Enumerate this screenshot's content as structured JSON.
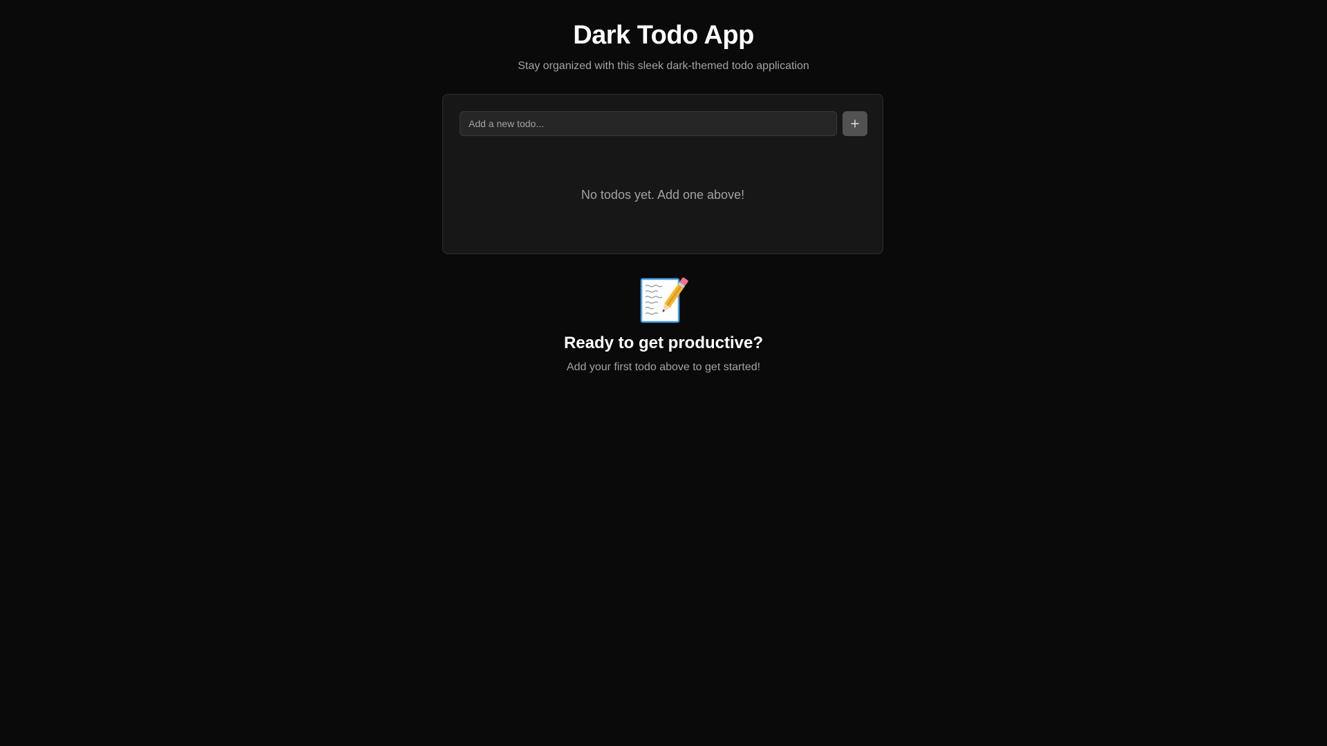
{
  "header": {
    "title": "Dark Todo App",
    "subtitle": "Stay organized with this sleek dark-themed todo application"
  },
  "todo_form": {
    "input_value": "",
    "input_placeholder": "Add a new todo...",
    "add_button_icon": "plus-icon"
  },
  "todo_list": {
    "items": [],
    "empty_message": "No todos yet. Add one above!"
  },
  "call_to_action": {
    "icon": "memo-icon",
    "heading": "Ready to get productive?",
    "text": "Add your first todo above to get started!"
  },
  "colors": {
    "background": "#0a0a0a",
    "card": "#171717",
    "input": "#262626",
    "button": "#525252",
    "muted_text": "#a3a3a3"
  }
}
